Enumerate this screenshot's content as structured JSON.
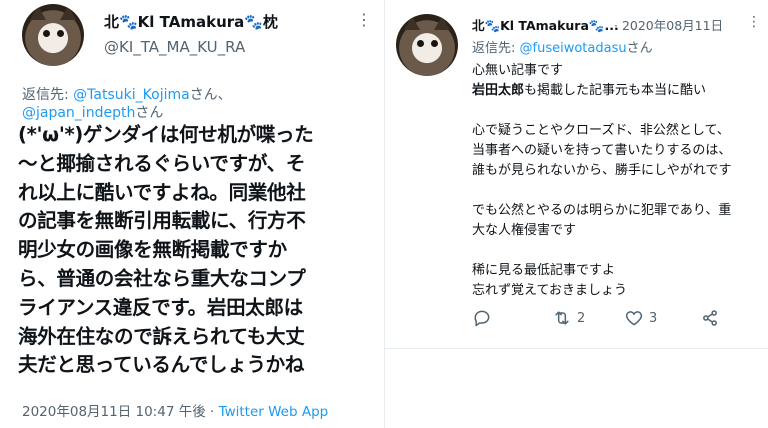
{
  "left_tweet": {
    "display_name": "北🐾Kl TAmakura🐾枕",
    "handle": "@KI_TA_MA_KU_RA",
    "reply_prefix": "返信先: ",
    "reply_to_1": "@Tatsuki_Kojima",
    "reply_san_1": "さん、",
    "reply_to_2": "@japan_indepth",
    "reply_san_2": "さん",
    "lines": [
      "(*'ω'*)ゲンダイは何せ机が喋った",
      "〜と揶揄されるぐらいですが、そ",
      "れ以上に酷いですよね。同業他社",
      "の記事を無断引用転載に、行方不",
      "明少女の画像を無断掲載ですか",
      "ら、普通の会社なら重大なコンプ",
      "ライアンス違反です。岩田太郎は",
      "海外在住なので訴えられても大丈",
      "夫だと思っているんでしょうかね"
    ],
    "timestamp": "2020年08月11日 10:47 午後",
    "separator": " · ",
    "source": "Twitter Web App",
    "more_icon": "more-vertical-icon"
  },
  "right_tweet": {
    "display_name": "北🐾Kl TAmakura🐾...",
    "date": "· 2020年08月11日",
    "reply_prefix": "返信先: ",
    "reply_to": "@fuseiwotadasu",
    "reply_san": "さん",
    "lines": [
      "心無い記事です",
      "岩田太郎も掲載した記事元も本当に酷い",
      "",
      "心で疑うことやクローズド、非公然として、",
      "当事者への疑いを持って書いたりするのは、",
      "誰もが見られないから、勝手にしやがれです",
      "",
      "でも公然とやるのは明らかに犯罪であり、重",
      "大な人権侵害です",
      "",
      "稀に見る最低記事ですよ",
      "忘れず覚えておきましょう"
    ],
    "bold_prefix": "岩田太郎",
    "actions": {
      "reply_count": "",
      "retweet_count": "2",
      "like_count": "3"
    }
  }
}
